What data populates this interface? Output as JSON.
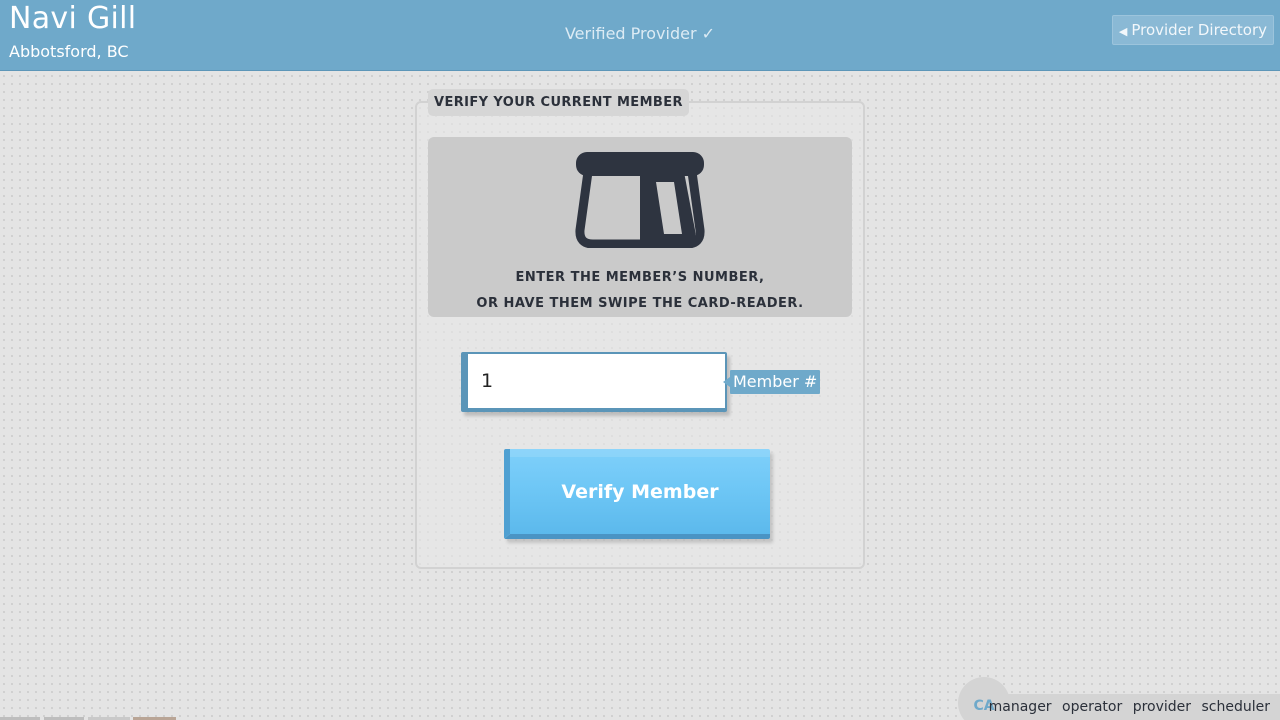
{
  "header": {
    "provider_name": "Navi Gill",
    "location": "Abbotsford, BC",
    "verified_label": "Verified Provider ✓",
    "directory_button": {
      "arrow": "◀",
      "label": "Provider Directory"
    },
    "colors": {
      "bar": "#6fa9ca"
    }
  },
  "panel": {
    "title": "VERIFY YOUR CURRENT MEMBER",
    "icon": "card-reader-icon",
    "instructions": {
      "line1": "ENTER THE MEMBER’S NUMBER,",
      "line2": "OR HAVE THEM SWIPE THE CARD-READER."
    },
    "member_input": {
      "value": "1",
      "label": "Member #"
    },
    "verify_button": {
      "label": "Verify Member",
      "color": "#6dc6f5"
    }
  },
  "footer": {
    "country_code": "CA",
    "roles": [
      "manager",
      "operator",
      "provider",
      "scheduler"
    ]
  }
}
